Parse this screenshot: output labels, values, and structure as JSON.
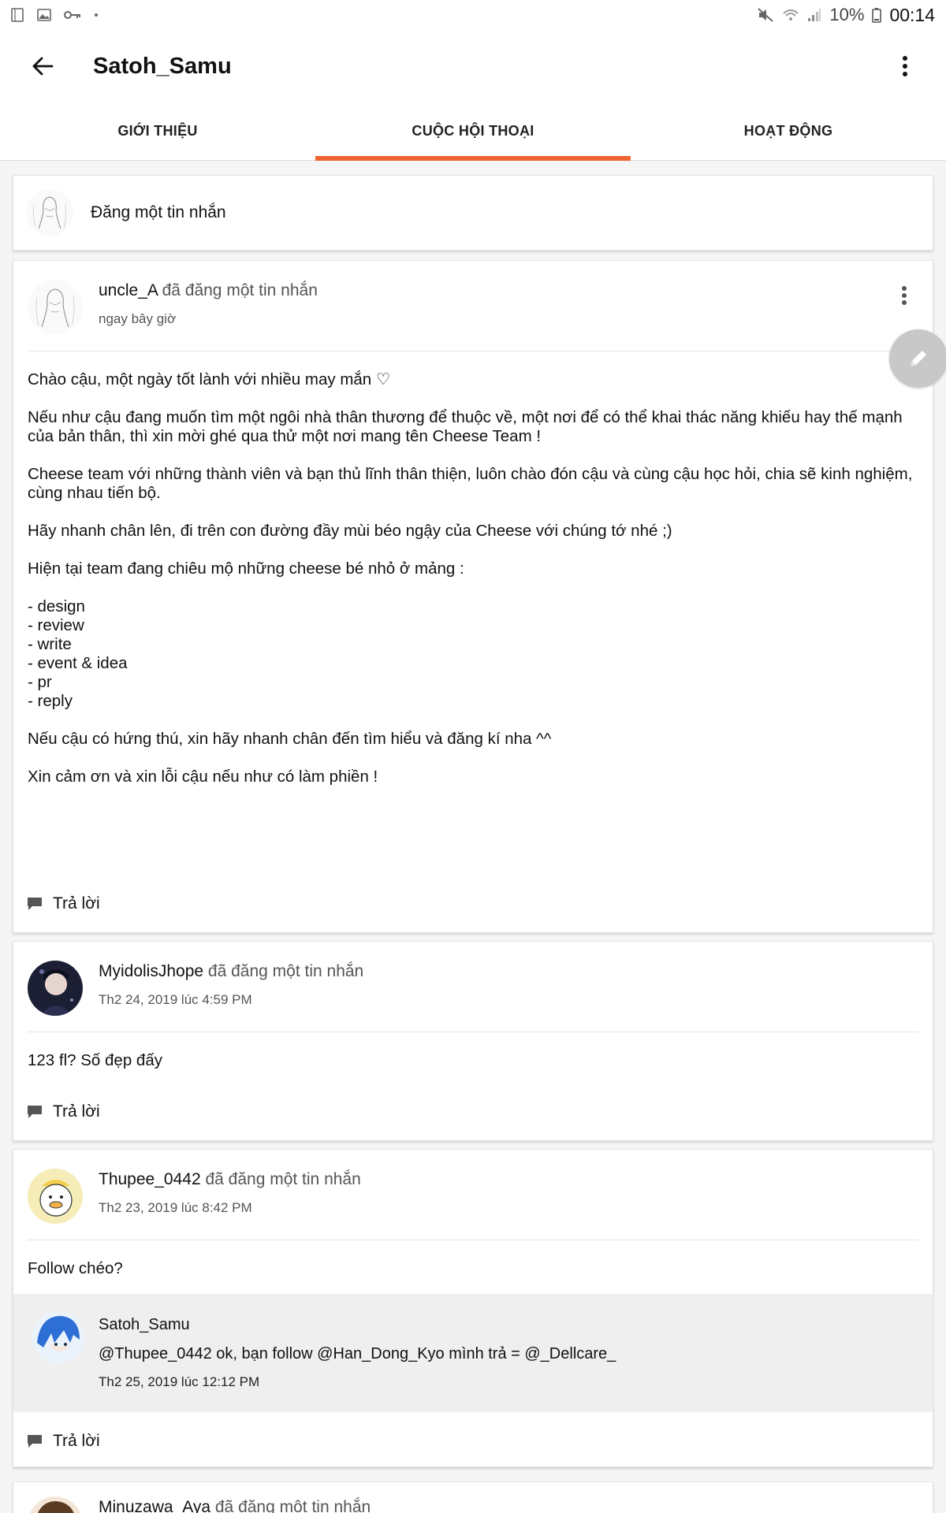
{
  "status_bar": {
    "battery_percent": "10%",
    "time": "00:14"
  },
  "app_bar": {
    "title": "Satoh_Samu"
  },
  "tabs": [
    {
      "label": "GIỚI THIỆU",
      "active": false
    },
    {
      "label": "CUỘC HỘI THOẠI",
      "active": true
    },
    {
      "label": "HOẠT ĐỘNG",
      "active": false
    }
  ],
  "compose": {
    "label": "Đăng một tin nhắn"
  },
  "posts": [
    {
      "author": "uncle_A",
      "verb": "đã đăng một tin nhắn",
      "time": "ngay bây giờ",
      "paragraphs": [
        "Chào cậu, một ngày tốt lành với nhiều may mắn ♡",
        "Nếu như cậu đang muốn tìm một ngôi nhà thân thương để thuộc về, một nơi để có thể khai thác năng khiếu hay thế mạnh của bản thân, thì xin mời ghé qua thử một nơi mang tên Cheese Team !",
        "Cheese team với những thành viên và bạn thủ lĩnh thân thiện, luôn chào đón cậu và cùng cậu học hỏi, chia sẽ kinh nghiệm, cùng nhau tiến bộ.",
        "Hãy nhanh chân lên, đi trên con đường đầy mùi béo ngậy của Cheese với chúng tớ nhé ;)",
        "Hiện tại team đang chiêu mộ những cheese bé nhỏ ở mảng :",
        "- design\n- review\n- write\n- event & idea\n- pr\n- reply",
        "Nếu cậu có hứng thú, xin hãy nhanh chân đến tìm hiểu và đăng kí nha ^^",
        "Xin cảm ơn và xin lỗi cậu nếu như có làm phiền !"
      ],
      "reply_label": "Trả lời"
    },
    {
      "author": "MyidolisJhope",
      "verb": "đã đăng một tin nhắn",
      "time": "Th2 24, 2019 lúc 4:59 PM",
      "paragraphs": [
        "123 fl? Số đẹp đấy"
      ],
      "reply_label": "Trả lời"
    },
    {
      "author": "Thupee_0442",
      "verb": "đã đăng một tin nhắn",
      "time": "Th2 23, 2019 lúc 8:42 PM",
      "paragraphs": [
        "Follow chéo?"
      ],
      "reply": {
        "author": "Satoh_Samu",
        "text": "@Thupee_0442  ok, bạn follow @Han_Dong_Kyo mình trả = @_Dellcare_",
        "time": "Th2 25, 2019 lúc 12:12 PM"
      },
      "reply_label": "Trả lời"
    },
    {
      "author": "Minuzawa_Aya",
      "verb": "đã đăng một tin nhắn"
    }
  ],
  "colors": {
    "accent": "#ef6430",
    "fab": "#c8c8c8"
  },
  "icons": {
    "back": "arrow-left-icon",
    "more": "more-vert-icon",
    "reply": "comment-icon",
    "fab": "pencil-icon"
  }
}
